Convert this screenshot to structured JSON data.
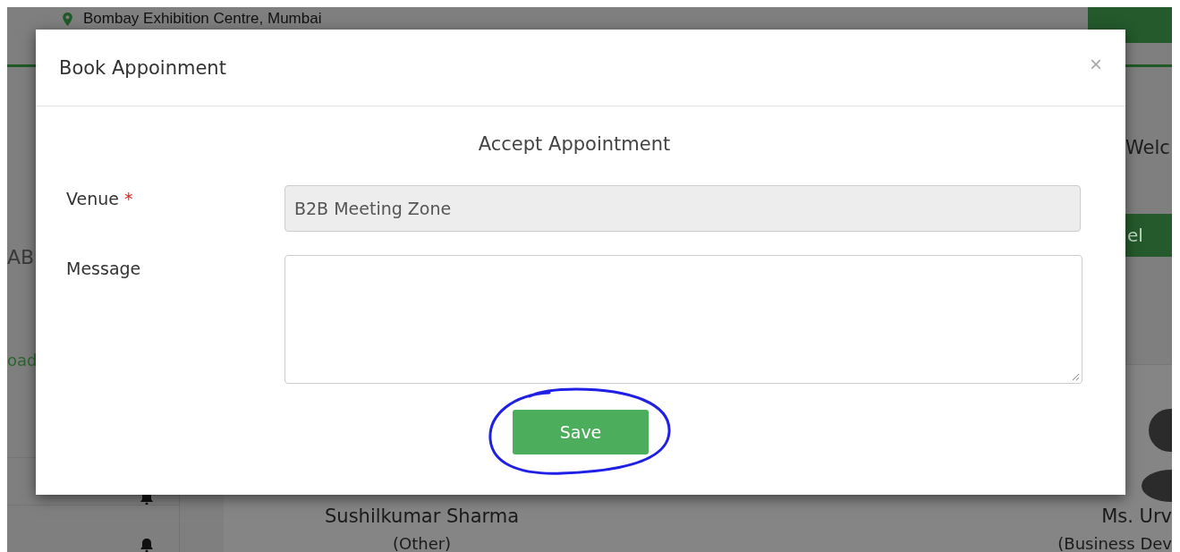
{
  "background": {
    "location": "Bombay Exhibition Centre, Mumbai",
    "sidebar_texts": [
      {
        "kind": "heading",
        "text": "AB"
      },
      {
        "kind": "link",
        "text": "oad"
      }
    ],
    "welcome": "Welc",
    "button": "el",
    "profiles": [
      {
        "name": "Sushilkumar Sharma",
        "role": "(Other)"
      },
      {
        "name": "Ms. Urv",
        "role": "(Business Dev"
      }
    ]
  },
  "modal": {
    "title": "Book Appoinment",
    "close": "×",
    "heading": "Accept Appointment",
    "required_mark": "*",
    "fields": [
      {
        "label": "Venue",
        "required": true,
        "kind": "input",
        "value": "B2B Meeting Zone",
        "disabled": true
      },
      {
        "label": "Message",
        "required": false,
        "kind": "textarea",
        "disabled": false
      }
    ],
    "save_button": "Save"
  }
}
